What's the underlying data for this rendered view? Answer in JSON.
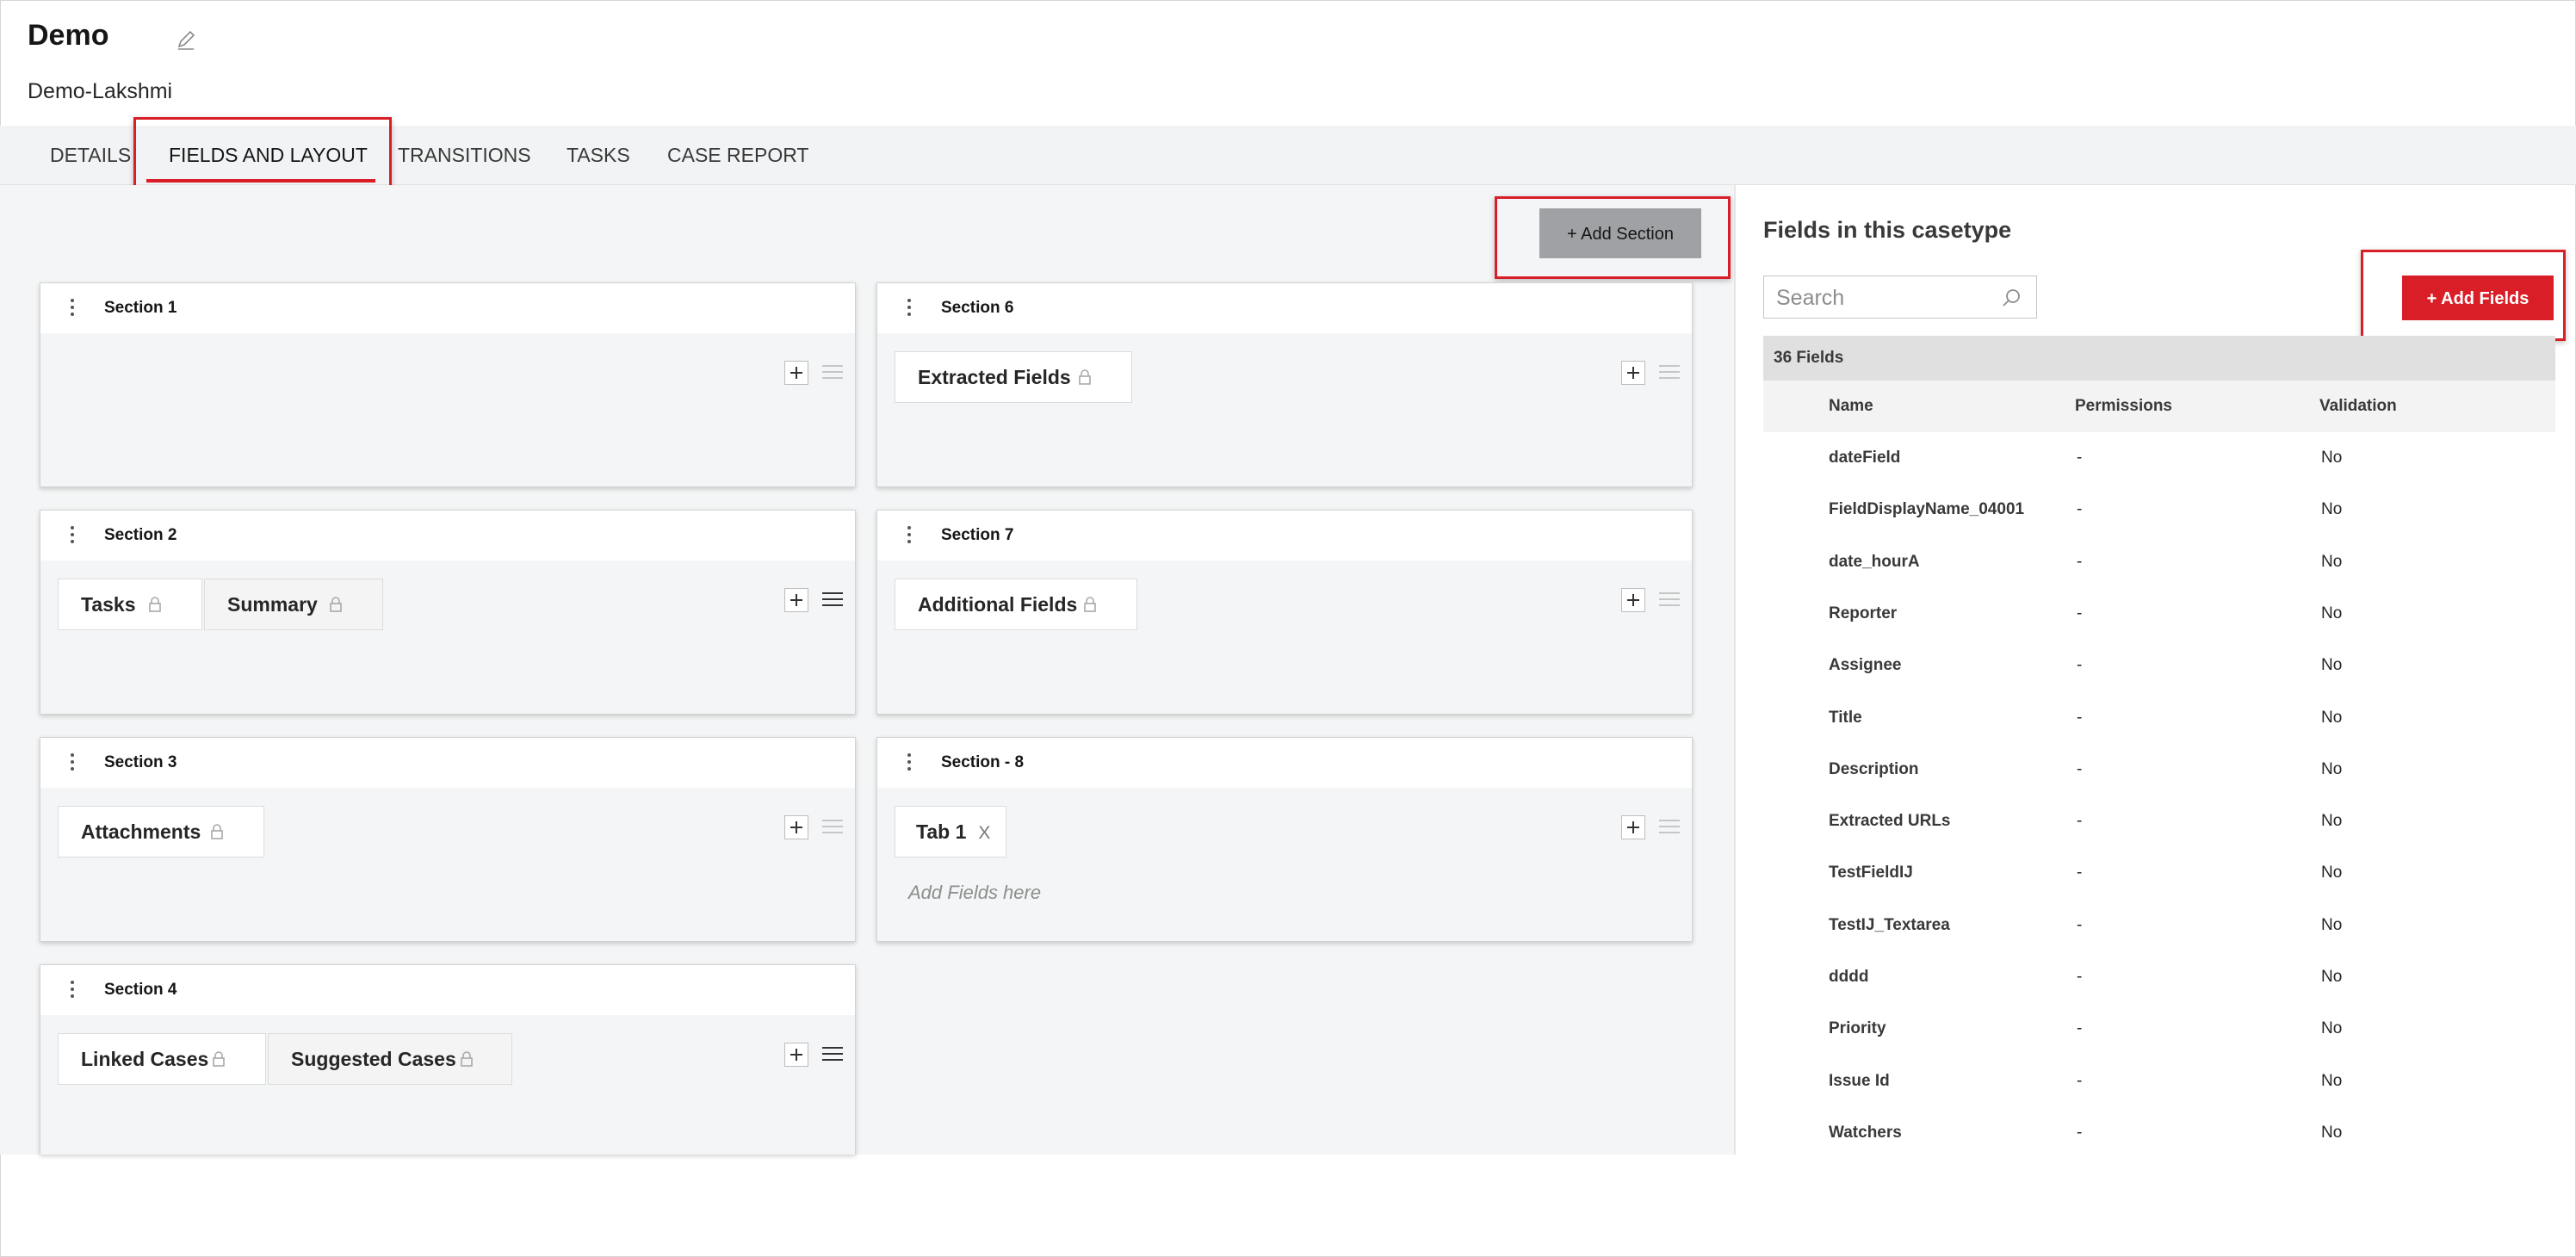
{
  "header": {
    "title": "Demo",
    "subtitle": "Demo-Lakshmi"
  },
  "tabs": [
    {
      "label": "DETAILS"
    },
    {
      "label": "FIELDS AND LAYOUT"
    },
    {
      "label": "TRANSITIONS"
    },
    {
      "label": "TASKS"
    },
    {
      "label": "CASE REPORT"
    }
  ],
  "active_tab": "FIELDS AND LAYOUT",
  "toolbar": {
    "add_section_label": "+ Add Section"
  },
  "sections": {
    "s1": {
      "name": "Section 1"
    },
    "s2": {
      "name": "Section 2",
      "fields": [
        "Tasks",
        "Summary"
      ]
    },
    "s3": {
      "name": "Section 3",
      "fields": [
        "Attachments"
      ]
    },
    "s4": {
      "name": "Section 4",
      "fields": [
        "Linked Cases",
        "Suggested Cases"
      ]
    },
    "s6": {
      "name": "Section 6",
      "fields": [
        "Extracted Fields"
      ]
    },
    "s7": {
      "name": "Section 7",
      "fields": [
        "Additional Fields"
      ]
    },
    "s8": {
      "name": "Section - 8",
      "tab_label": "Tab 1",
      "tab_close": "X",
      "empty_hint": "Add Fields here"
    }
  },
  "panel": {
    "title": "Fields in this casetype",
    "search_placeholder": "Search",
    "add_fields_label": "+ Add Fields",
    "count_label": "36 Fields",
    "columns": [
      "Name",
      "Permissions",
      "Validation"
    ],
    "rows": [
      {
        "name": "dateField",
        "permissions": "-",
        "validation": "No"
      },
      {
        "name": "FieldDisplayName_04001",
        "permissions": "-",
        "validation": "No"
      },
      {
        "name": "date_hourA",
        "permissions": "-",
        "validation": "No"
      },
      {
        "name": "Reporter",
        "permissions": "-",
        "validation": "No"
      },
      {
        "name": "Assignee",
        "permissions": "-",
        "validation": "No"
      },
      {
        "name": "Title",
        "permissions": "-",
        "validation": "No"
      },
      {
        "name": "Description",
        "permissions": "-",
        "validation": "No"
      },
      {
        "name": "Extracted URLs",
        "permissions": "-",
        "validation": "No"
      },
      {
        "name": "TestFieldIJ",
        "permissions": "-",
        "validation": "No"
      },
      {
        "name": "TestIJ_Textarea",
        "permissions": "-",
        "validation": "No"
      },
      {
        "name": "dddd",
        "permissions": "-",
        "validation": "No"
      },
      {
        "name": "Priority",
        "permissions": "-",
        "validation": "No"
      },
      {
        "name": "Issue Id",
        "permissions": "-",
        "validation": "No"
      },
      {
        "name": "Watchers",
        "permissions": "-",
        "validation": "No"
      }
    ]
  },
  "colors": {
    "accent": "#da1e28",
    "add_section_bg": "#9fa1a4",
    "tab_bar_bg": "#f2f3f4",
    "canvas_bg": "#f4f5f6"
  },
  "icons": [
    "pencil-icon",
    "kebab-icon",
    "plus-icon",
    "drag-handle-icon",
    "lock-icon",
    "search-icon"
  ]
}
